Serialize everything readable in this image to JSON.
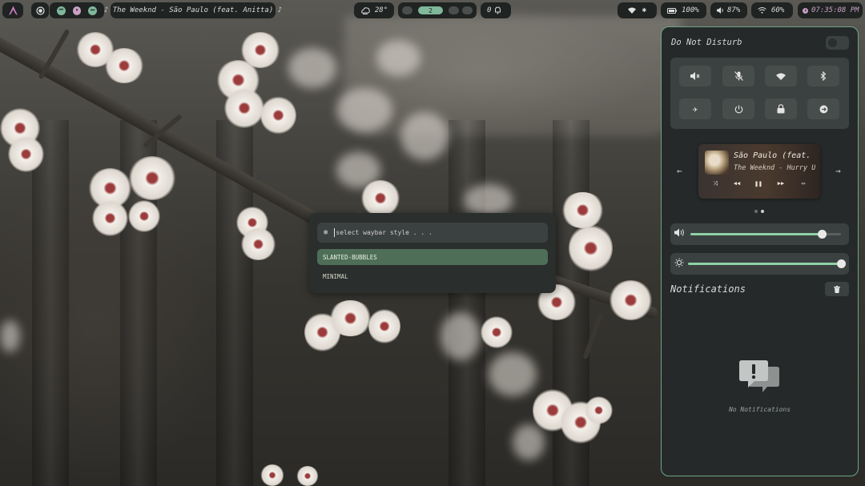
{
  "topbar": {
    "launcher_icon": "arch-logo-icon",
    "media": {
      "prev_icon": "skip-previous-icon",
      "pause_icon": "pause-icon",
      "next_icon": "skip-next-icon",
      "now_playing": "♪ The Weeknd - São Paulo (feat. Anitta) ♪"
    },
    "weather": {
      "icon": "weather-icon",
      "temp": "28°"
    },
    "workspaces": {
      "active_label": "2"
    },
    "notifications": {
      "count": "0",
      "icon": "bell-icon"
    },
    "tray": {
      "wifi_icon": "wifi-icon",
      "bluetooth_icon": "bluetooth-icon"
    },
    "battery": {
      "icon": "battery-icon",
      "value": "100%"
    },
    "volume": {
      "icon": "volume-icon",
      "value": "87%"
    },
    "network": {
      "icon": "wifi-icon",
      "value": "60%"
    },
    "clock": {
      "icon": "clock-icon",
      "value": "07:35:08 PM"
    }
  },
  "picker": {
    "icon": "snowflake-icon",
    "placeholder": "select waybar style . . .",
    "items": [
      "SLANTED-BUBBLES",
      "MINIMAL"
    ],
    "selected_index": 0
  },
  "control_center": {
    "dnd_label": "Do Not Disturb",
    "dnd_enabled": false,
    "quick_settings": [
      "volume-mute-icon",
      "mic-mute-icon",
      "wifi-icon",
      "bluetooth-icon",
      "airplane-mode-icon",
      "power-icon",
      "lock-icon",
      "logout-icon"
    ],
    "player": {
      "title": "São Paulo (feat. Anitta)",
      "artist": "The Weeknd - Hurry Up Tomorrow",
      "shuffle_label": "⤨",
      "prev_icon": "rewind-icon",
      "play_icon": "pause-icon",
      "next_icon": "fast-forward-icon",
      "repeat_icon": "repeat-icon",
      "page_prev_icon": "arrow-left-icon",
      "page_next_icon": "arrow-right-icon",
      "page_count": 2,
      "page_active": 1
    },
    "volume_slider": {
      "icon": "speaker-icon",
      "level": 0.87
    },
    "brightness_slider": {
      "icon": "brightness-icon",
      "level": 1.0
    },
    "notifications_title": "Notifications",
    "clear_icon": "trash-icon",
    "empty_icon": "notification-alert-icon",
    "empty_text": "No Notifications"
  },
  "colors": {
    "accent": "#7fb89a",
    "bar_bg": "#1f2322",
    "panel_bg": "#25292a",
    "panel_border": "#6fa585",
    "selected_item": "#4e6e57"
  }
}
